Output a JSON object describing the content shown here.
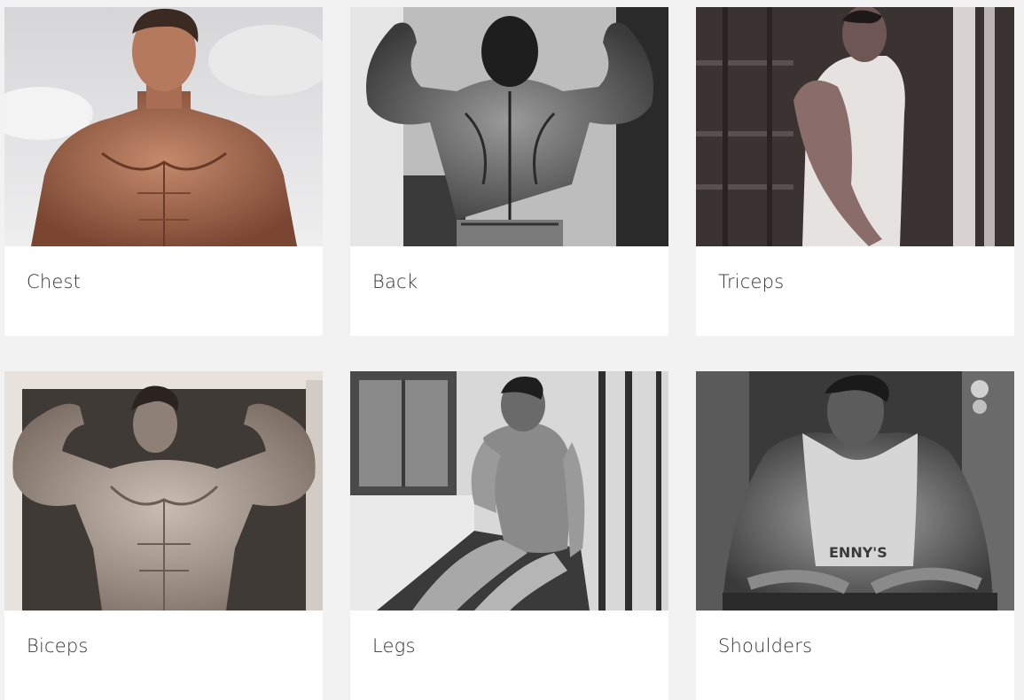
{
  "categories": [
    {
      "label": "Chest",
      "photo_tone": "color-sepia",
      "photo_desc": "chest-photo"
    },
    {
      "label": "Back",
      "photo_tone": "bw",
      "photo_desc": "back-photo"
    },
    {
      "label": "Triceps",
      "photo_tone": "sepia-dark",
      "photo_desc": "triceps-photo"
    },
    {
      "label": "Biceps",
      "photo_tone": "sepia",
      "photo_desc": "biceps-photo"
    },
    {
      "label": "Legs",
      "photo_tone": "bw",
      "photo_desc": "legs-photo"
    },
    {
      "label": "Shoulders",
      "photo_tone": "bw",
      "photo_desc": "shoulders-photo"
    }
  ],
  "colors": {
    "page_background": "#f2f2f2",
    "card_background": "#ffffff",
    "title_text": "#333333"
  }
}
